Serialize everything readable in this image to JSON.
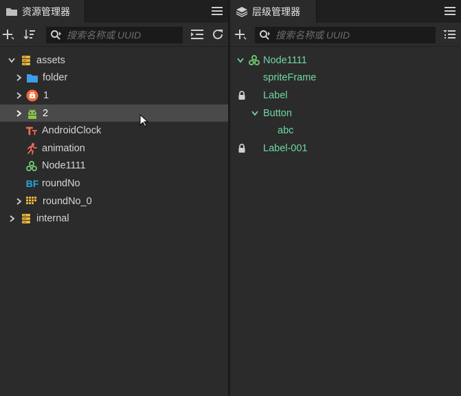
{
  "assets": {
    "title": "资源管理器",
    "search_placeholder": "搜索名称或 UUID",
    "tree": [
      {
        "label": "assets",
        "icon": "database-icon"
      },
      {
        "label": "folder",
        "icon": "folder-icon"
      },
      {
        "label": "1",
        "icon": "prefab-icon"
      },
      {
        "label": "2",
        "icon": "android-icon"
      },
      {
        "label": "AndroidClock",
        "icon": "text-font-icon"
      },
      {
        "label": "animation",
        "icon": "animation-icon"
      },
      {
        "label": "Node1111",
        "icon": "node-prefab-icon"
      },
      {
        "label": "roundNo",
        "icon": "bitmap-font-icon",
        "icon_text": "BF"
      },
      {
        "label": "roundNo_0",
        "icon": "sprite-atlas-icon"
      },
      {
        "label": "internal",
        "icon": "database-icon"
      }
    ]
  },
  "hierarchy": {
    "title": "层级管理器",
    "search_placeholder": "搜索名称或 UUID",
    "tree": [
      {
        "label": "Node1111"
      },
      {
        "label": "spriteFrame"
      },
      {
        "label": "Label"
      },
      {
        "label": "Button"
      },
      {
        "label": "abc"
      },
      {
        "label": "Label-001"
      }
    ]
  },
  "colors": {
    "background": "#2b2b2b",
    "selected_row": "#4a4a4a",
    "node_text": "#6fd8a4",
    "folder_blue": "#3c9fe6",
    "database_yellow": "#e8b53a",
    "android_green": "#8bc34a",
    "prefab_orange": "#f26b3a"
  }
}
